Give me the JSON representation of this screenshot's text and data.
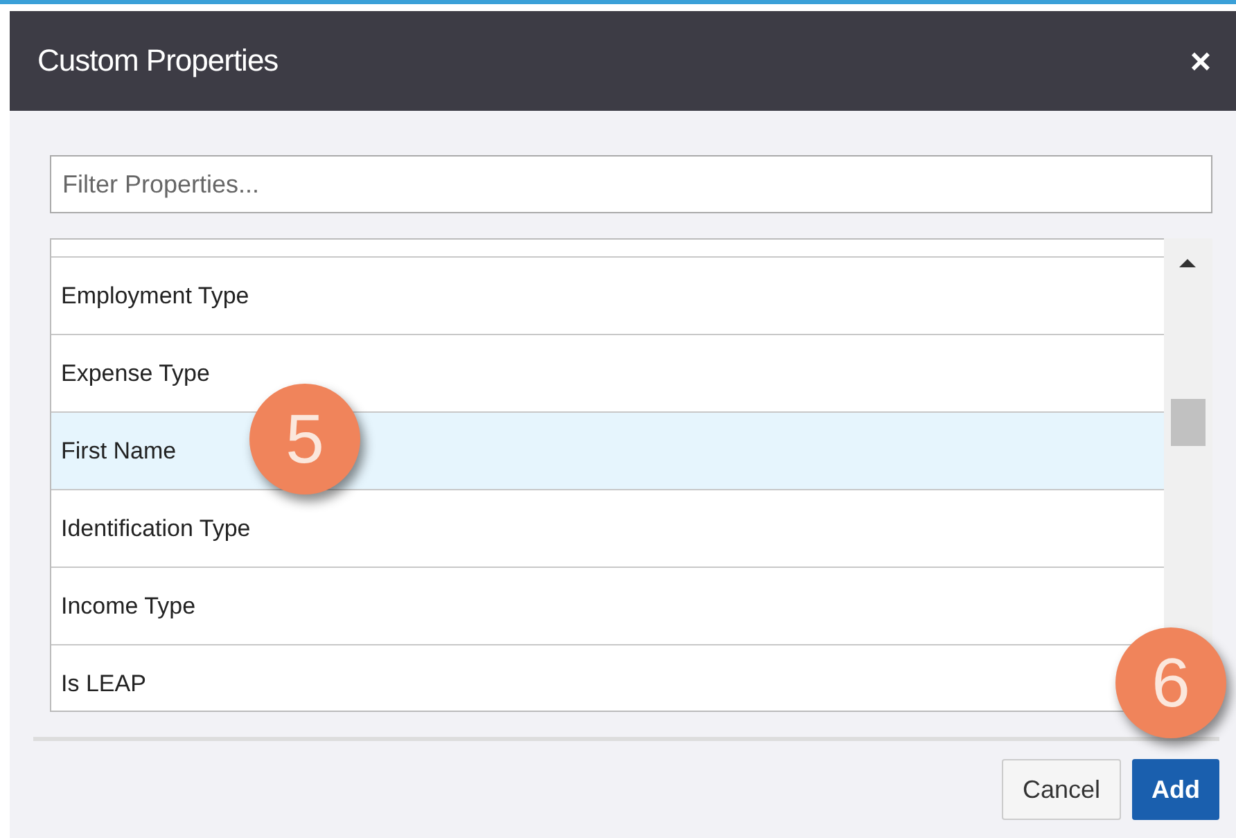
{
  "dialog": {
    "title": "Custom Properties",
    "close": "×"
  },
  "filter": {
    "placeholder": "Filter Properties..."
  },
  "properties": [
    {
      "selected": false
    },
    {
      "label": "Employment Type",
      "selected": false
    },
    {
      "label": "Expense Type",
      "selected": false
    },
    {
      "label": "First Name",
      "selected": true
    },
    {
      "label": "Identification Type",
      "selected": false
    },
    {
      "label": "Income Type",
      "selected": false
    },
    {
      "label": "Is LEAP",
      "selected": false
    }
  ],
  "buttons": [
    {
      "label": "Cancel",
      "kind": "secondary"
    },
    {
      "label": "Add",
      "kind": "primary"
    }
  ],
  "callouts": [
    {
      "label": "5"
    },
    {
      "label": "6"
    }
  ]
}
